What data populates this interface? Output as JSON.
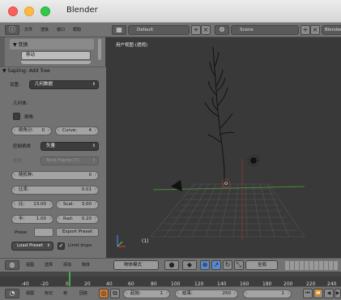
{
  "window": {
    "title": "Blender"
  },
  "header": {
    "menus": [
      "文件",
      "渲染",
      "窗口",
      "帮助"
    ],
    "layout": "Default",
    "scene": "Scene",
    "engine": "Blender"
  },
  "toolshelf": {
    "panel_transform": "▼ 变换",
    "move_button": "移动"
  },
  "operator": {
    "title": "▼ Sapling: Add Tree",
    "settings_label": "设置:",
    "settings_value": "几何数据",
    "geometry_label": "几何体:",
    "bevel_label": "倒角",
    "bevel_res_label": "倒角分:",
    "bevel_res_value": "0",
    "curve_res_label": "Curve:",
    "curve_res_value": "4",
    "handles_label": "控制柄类",
    "handles_value": "矢量",
    "shape_label": "形状",
    "shape_value": "Tend Flame (7)",
    "seed_label": "随机种:",
    "seed_value": "0",
    "ratio_label": "比率:",
    "ratio_value": "0.01",
    "scale_a_label": "比:",
    "scale_a_value": "13.00",
    "scale_b_label": "Scal:",
    "scale_b_value": "3.00",
    "radius_a_label": "半:",
    "radius_a_value": "1.00",
    "radius_b_label": "Rad:",
    "radius_b_value": "0.20",
    "prese_label": "Prese",
    "export_preset": "Export Preset",
    "load_preset": "Load Preset",
    "limit_imports": "Limit Impo"
  },
  "viewport": {
    "label": "用户视图 (透视)",
    "frame": "(1)"
  },
  "view3d_bar": {
    "menus": [
      "视图",
      "选择",
      "添加",
      "物体"
    ],
    "mode": "物体模式",
    "global": "全局"
  },
  "timeline": {
    "ticks": [
      "-40",
      "-20",
      "0",
      "20",
      "40",
      "60",
      "80",
      "100",
      "120",
      "140",
      "160",
      "180",
      "200",
      "220",
      "240"
    ]
  },
  "timeline_bar": {
    "menus": [
      "视图",
      "标记",
      "帧",
      "回放"
    ],
    "start_label": "起始:",
    "start_value": "1",
    "end_label": "结束:",
    "end_value": "250",
    "current_value": "1"
  }
}
